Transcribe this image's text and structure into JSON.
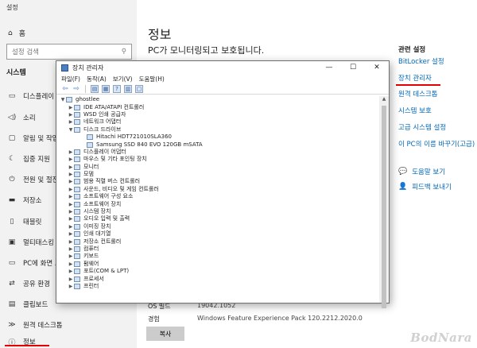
{
  "settings": {
    "window_title": "설정",
    "home_label": "홈",
    "search_placeholder": "설정 검색",
    "section_label": "시스템",
    "nav": [
      {
        "label": "디스플레이",
        "icon": "monitor-icon"
      },
      {
        "label": "소리",
        "icon": "speaker-icon"
      },
      {
        "label": "알림 및 작업",
        "icon": "notification-icon"
      },
      {
        "label": "집중 지원",
        "icon": "focus-assist-icon"
      },
      {
        "label": "전원 및 절전",
        "icon": "power-icon"
      },
      {
        "label": "저장소",
        "icon": "storage-icon"
      },
      {
        "label": "태블릿",
        "icon": "tablet-icon"
      },
      {
        "label": "멀티태스킹",
        "icon": "multitasking-icon"
      },
      {
        "label": "PC에 화면 표",
        "icon": "project-icon"
      },
      {
        "label": "공유 환경",
        "icon": "share-icon"
      },
      {
        "label": "클립보드",
        "icon": "clipboard-icon"
      },
      {
        "label": "원격 데스크톱",
        "icon": "remote-desktop-icon"
      },
      {
        "label": "정보",
        "icon": "info-icon"
      }
    ],
    "main": {
      "title": "정보",
      "subtitle": "PC가 모니터링되고 보호됩니다.",
      "os_build_label": "OS 빌드",
      "os_build_value": "19042.1052",
      "experience_label": "경험",
      "experience_value": "Windows Feature Experience Pack 120.2212.2020.0",
      "copy_button": "복사"
    },
    "related": {
      "title": "관련 설정",
      "links": [
        "BitLocker 설정",
        "장치 관리자",
        "원격 데스크톱",
        "시스템 보호",
        "고급 시스템 설정",
        "이 PC의 이름 바꾸기(고급)"
      ],
      "help": [
        {
          "label": "도움말 보기",
          "icon": "help-icon"
        },
        {
          "label": "피드백 보내기",
          "icon": "feedback-icon"
        }
      ]
    }
  },
  "device_manager": {
    "title": "장치 관리자",
    "window_controls": [
      "—",
      "☐",
      "✕"
    ],
    "menu": [
      "파일(F)",
      "동작(A)",
      "보기(V)",
      "도움말(H)"
    ],
    "root": "ghostlee",
    "tree": [
      {
        "label": "IDE ATA/ATAPI 컨트롤러",
        "level": 1,
        "expanded": false
      },
      {
        "label": "WSD 인쇄 공급자",
        "level": 1,
        "expanded": false
      },
      {
        "label": "네트워크 어댑터",
        "level": 1,
        "expanded": false
      },
      {
        "label": "디스크 드라이브",
        "level": 1,
        "expanded": true
      },
      {
        "label": "Hitachi HDT721010SLA360",
        "level": 2,
        "expanded": null
      },
      {
        "label": "Samsung SSD 840 EVO 120GB mSATA",
        "level": 2,
        "expanded": null
      },
      {
        "label": "디스플레이 어댑터",
        "level": 1,
        "expanded": false
      },
      {
        "label": "마우스 및 기타 포인팅 장치",
        "level": 1,
        "expanded": false
      },
      {
        "label": "모니터",
        "level": 1,
        "expanded": false
      },
      {
        "label": "모뎀",
        "level": 1,
        "expanded": false
      },
      {
        "label": "범용 직렬 버스 컨트롤러",
        "level": 1,
        "expanded": false
      },
      {
        "label": "사운드, 비디오 및 게임 컨트롤러",
        "level": 1,
        "expanded": false
      },
      {
        "label": "소프트웨어 구성 요소",
        "level": 1,
        "expanded": false
      },
      {
        "label": "소프트웨어 장치",
        "level": 1,
        "expanded": false
      },
      {
        "label": "시스템 장치",
        "level": 1,
        "expanded": false
      },
      {
        "label": "오디오 입력 및 출력",
        "level": 1,
        "expanded": false
      },
      {
        "label": "이미징 장치",
        "level": 1,
        "expanded": false
      },
      {
        "label": "인쇄 대기열",
        "level": 1,
        "expanded": false
      },
      {
        "label": "저장소 컨트롤러",
        "level": 1,
        "expanded": false
      },
      {
        "label": "컴퓨터",
        "level": 1,
        "expanded": false
      },
      {
        "label": "키보드",
        "level": 1,
        "expanded": false
      },
      {
        "label": "펌웨어",
        "level": 1,
        "expanded": false
      },
      {
        "label": "포트(COM & LPT)",
        "level": 1,
        "expanded": false
      },
      {
        "label": "프로세서",
        "level": 1,
        "expanded": false
      },
      {
        "label": "프린터",
        "level": 1,
        "expanded": false
      }
    ]
  },
  "watermark": "BodNara",
  "colors": {
    "accent_link": "#0067b8",
    "highlight_underline": "#e30000",
    "sidebar_bg": "#f2f2f2"
  }
}
